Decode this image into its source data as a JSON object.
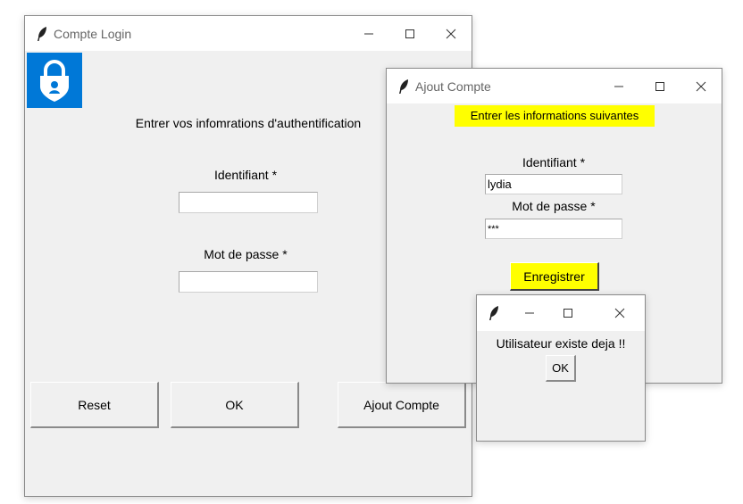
{
  "login": {
    "title": "Compte Login",
    "heading": "Entrer vos infomrations d'authentification",
    "id_label": "Identifiant *",
    "id_value": "",
    "pwd_label": "Mot de passe *",
    "pwd_value": "",
    "reset_label": "Reset",
    "ok_label": "OK",
    "add_label": "Ajout Compte",
    "logo_color": "#0078d7"
  },
  "ajout": {
    "title": "Ajout Compte",
    "heading": "Entrer les informations suivantes",
    "id_label": "Identifiant *",
    "id_value": "lydia",
    "pwd_label": "Mot de passe *",
    "pwd_value": "***",
    "save_label": "Enregistrer",
    "highlight_color": "#ffff00"
  },
  "alert": {
    "title": "",
    "message": "Utilisateur existe deja !!",
    "ok_label": "OK"
  }
}
